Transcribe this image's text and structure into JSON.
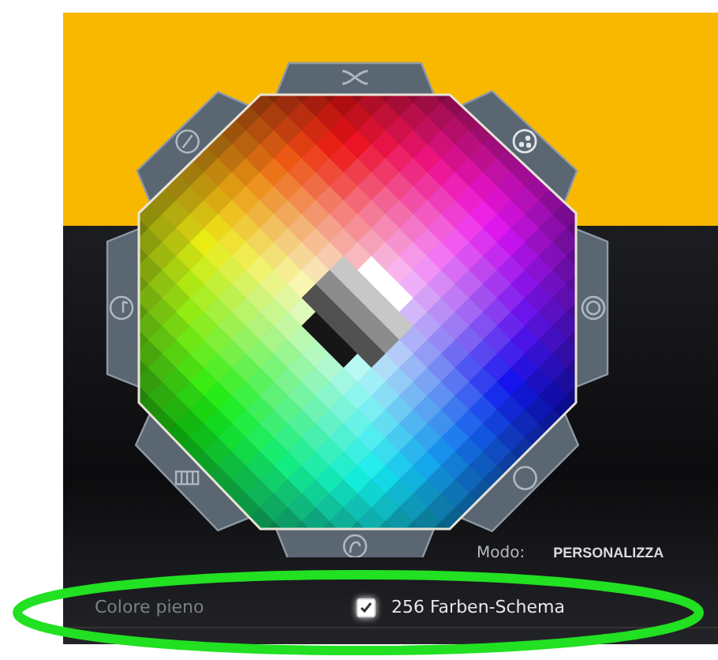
{
  "mode": {
    "label": "Modo:",
    "value": "PERSONALIZZA"
  },
  "options": [
    {
      "kind": "text",
      "label": "Colore pieno"
    },
    {
      "kind": "checkbox",
      "label": "256 Farben-Schema",
      "checked": true
    }
  ]
}
